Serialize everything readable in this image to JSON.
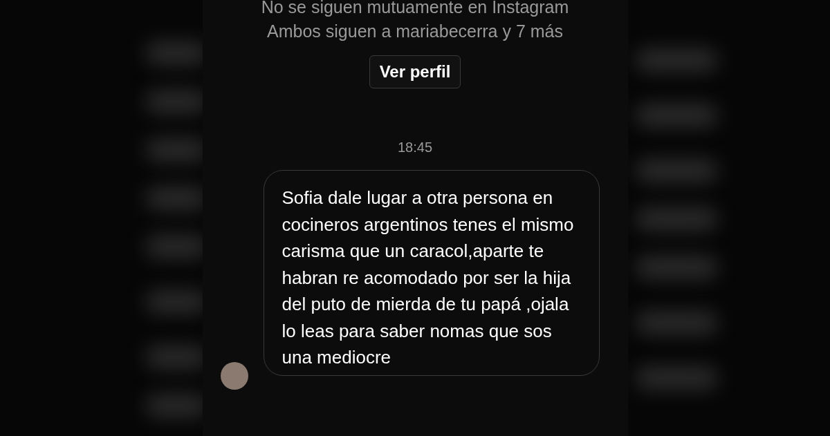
{
  "profile_info": {
    "follow_status": "No se siguen mutuamente en Instagram",
    "mutual": "Ambos siguen a mariabecerra y 7 más",
    "view_profile_button": "Ver perfil"
  },
  "timestamp": "18:45",
  "message": {
    "text": "Sofia dale lugar a otra persona en cocineros argentinos tenes el mismo carisma que un caracol,aparte te habran re acomodado por ser la hija del puto de mierda de tu papá ,ojala lo leas para saber nomas que sos una mediocre"
  }
}
